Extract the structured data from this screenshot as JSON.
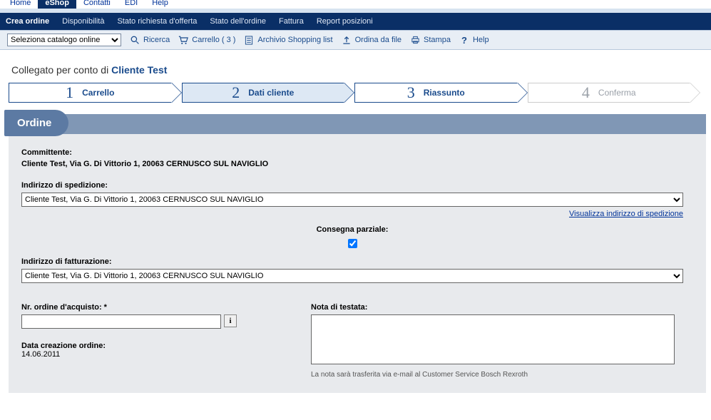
{
  "top_tabs": {
    "home": "Home",
    "eshop": "eShop",
    "contatti": "Contatti",
    "edi": "EDI",
    "help": "Help"
  },
  "menu": {
    "crea_ordine": "Crea ordine",
    "disponibilita": "Disponibilità",
    "stato_offerta": "Stato richiesta d'offerta",
    "stato_ordine": "Stato dell'ordine",
    "fattura": "Fattura",
    "report": "Report posizioni"
  },
  "toolbar": {
    "catalog_option": "Seleziona catalogo online",
    "ricerca": "Ricerca",
    "carrello": "Carrello ( 3 )",
    "archivio": "Archivio Shopping list",
    "ordina_file": "Ordina da file",
    "stampa": "Stampa",
    "help": "Help"
  },
  "connected": {
    "prefix": "Collegato per conto di ",
    "client": "Cliente Test"
  },
  "steps": {
    "s1_num": "1",
    "s1_label": "Carrello",
    "s2_num": "2",
    "s2_label": "Dati cliente",
    "s3_num": "3",
    "s3_label": "Riassunto",
    "s4_num": "4",
    "s4_label": "Conferma"
  },
  "ordine_tab": "Ordine",
  "form": {
    "committente_label": "Committente:",
    "committente_value": "Cliente Test, Via G. Di Vittorio 1, 20063 CERNUSCO SUL NAVIGLIO",
    "spedizione_label": "Indirizzo di spedizione:",
    "spedizione_option": "Cliente Test, Via G. Di Vittorio 1, 20063 CERNUSCO SUL NAVIGLIO",
    "visualizza_link": "Visualizza indirizzo di spedizione",
    "consegna_parziale_label": "Consegna parziale:",
    "fatturazione_label": "Indirizzo di fatturazione:",
    "fatturazione_option": "Cliente Test, Via G. Di Vittorio 1, 20063 CERNUSCO SUL NAVIGLIO",
    "nr_ordine_label": "Nr. ordine d'acquisto: *",
    "nota_testata_label": "Nota di testata:",
    "data_creazione_label": "Data creazione ordine:",
    "data_creazione_value": "14.06.2011",
    "foot_note": "La nota sarà trasferita via e-mail al Customer Service Bosch Rexroth"
  }
}
